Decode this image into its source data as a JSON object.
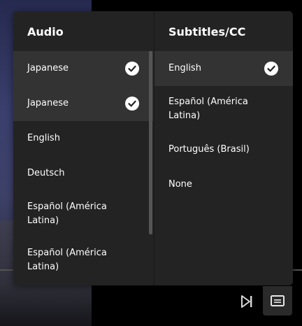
{
  "audio": {
    "title": "Audio",
    "items": [
      {
        "label": "Japanese",
        "selected": true
      },
      {
        "label": "Japanese",
        "selected": true
      },
      {
        "label": "English",
        "selected": false
      },
      {
        "label": "Deutsch",
        "selected": false
      },
      {
        "label": "Español (América Latina)",
        "selected": false
      },
      {
        "label": "Español (América Latina)",
        "selected": false
      }
    ]
  },
  "subtitles": {
    "title": "Subtitles/CC",
    "items": [
      {
        "label": "English",
        "selected": true
      },
      {
        "label": "Español (América Latina)",
        "selected": false
      },
      {
        "label": "Português (Brasil)",
        "selected": false
      },
      {
        "label": "None",
        "selected": false
      }
    ]
  },
  "controls": {
    "skip_icon": "skip-next-icon",
    "captions_icon": "captions-icon"
  },
  "colors": {
    "panel_bg": "#232323",
    "selected_bg": "#333333",
    "check_bg": "#ffffff"
  }
}
